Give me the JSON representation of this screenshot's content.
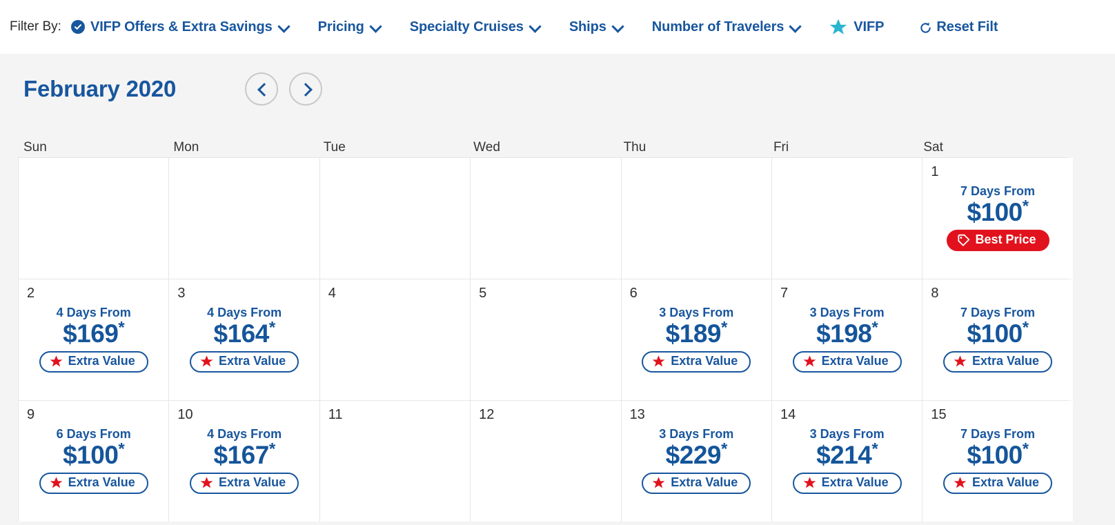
{
  "filter_bar": {
    "label": "Filter By:",
    "items": [
      {
        "id": "vifp-offers",
        "label": "VIFP Offers & Extra Savings",
        "icon": "check-circle-icon",
        "has_dropdown": true
      },
      {
        "id": "pricing",
        "label": "Pricing",
        "icon": null,
        "has_dropdown": true
      },
      {
        "id": "specialty-cruises",
        "label": "Specialty Cruises",
        "icon": null,
        "has_dropdown": true
      },
      {
        "id": "ships",
        "label": "Ships",
        "icon": null,
        "has_dropdown": true
      },
      {
        "id": "number-of-travelers",
        "label": "Number of Travelers",
        "icon": null,
        "has_dropdown": true
      },
      {
        "id": "vifp",
        "label": "VIFP",
        "icon": "star-icon",
        "has_dropdown": false
      },
      {
        "id": "reset-filters",
        "label": "Reset Filt",
        "icon": "reset-icon",
        "has_dropdown": false
      }
    ]
  },
  "calendar": {
    "month_title": "February 2020",
    "prev_label": "‹",
    "next_label": "›",
    "day_headers": [
      "Sun",
      "Mon",
      "Tue",
      "Wed",
      "Thu",
      "Fri",
      "Sat"
    ],
    "cells": [
      {
        "day": "",
        "offer": null
      },
      {
        "day": "",
        "offer": null
      },
      {
        "day": "",
        "offer": null
      },
      {
        "day": "",
        "offer": null
      },
      {
        "day": "",
        "offer": null
      },
      {
        "day": "",
        "offer": null
      },
      {
        "day": "1",
        "offer": {
          "duration": "7 Days From",
          "price": "$100",
          "asterisk": "*",
          "badge": "Best Price",
          "badge_type": "best",
          "badge_icon": "price-tag-icon"
        }
      },
      {
        "day": "2",
        "offer": {
          "duration": "4 Days From",
          "price": "$169",
          "asterisk": "*",
          "badge": "Extra Value",
          "badge_type": "extra",
          "badge_icon": "star-icon"
        }
      },
      {
        "day": "3",
        "offer": {
          "duration": "4 Days From",
          "price": "$164",
          "asterisk": "*",
          "badge": "Extra Value",
          "badge_type": "extra",
          "badge_icon": "star-icon"
        }
      },
      {
        "day": "4",
        "offer": null
      },
      {
        "day": "5",
        "offer": null
      },
      {
        "day": "6",
        "offer": {
          "duration": "3 Days From",
          "price": "$189",
          "asterisk": "*",
          "badge": "Extra Value",
          "badge_type": "extra",
          "badge_icon": "star-icon"
        }
      },
      {
        "day": "7",
        "offer": {
          "duration": "3 Days From",
          "price": "$198",
          "asterisk": "*",
          "badge": "Extra Value",
          "badge_type": "extra",
          "badge_icon": "star-icon"
        }
      },
      {
        "day": "8",
        "offer": {
          "duration": "7 Days From",
          "price": "$100",
          "asterisk": "*",
          "badge": "Extra Value",
          "badge_type": "extra",
          "badge_icon": "star-icon"
        }
      },
      {
        "day": "9",
        "offer": {
          "duration": "6 Days From",
          "price": "$100",
          "asterisk": "*",
          "badge": "Extra Value",
          "badge_type": "extra",
          "badge_icon": "star-icon"
        }
      },
      {
        "day": "10",
        "offer": {
          "duration": "4 Days From",
          "price": "$167",
          "asterisk": "*",
          "badge": "Extra Value",
          "badge_type": "extra",
          "badge_icon": "star-icon"
        }
      },
      {
        "day": "11",
        "offer": null
      },
      {
        "day": "12",
        "offer": null
      },
      {
        "day": "13",
        "offer": {
          "duration": "3 Days From",
          "price": "$229",
          "asterisk": "*",
          "badge": "Extra Value",
          "badge_type": "extra",
          "badge_icon": "star-icon"
        }
      },
      {
        "day": "14",
        "offer": {
          "duration": "3 Days From",
          "price": "$214",
          "asterisk": "*",
          "badge": "Extra Value",
          "badge_type": "extra",
          "badge_icon": "star-icon"
        }
      },
      {
        "day": "15",
        "offer": {
          "duration": "7 Days From",
          "price": "$100",
          "asterisk": "*",
          "badge": "Extra Value",
          "badge_type": "extra",
          "badge_icon": "star-icon"
        }
      }
    ]
  },
  "colors": {
    "brand_blue": "#18569e",
    "price_blue": "#15559a",
    "best_price_red": "#e1121d",
    "star_red": "#e1121d",
    "vifp_teal": "#29b5ce",
    "page_bg": "#f4f4f4",
    "cell_bg": "#ffffff",
    "grid_line": "#e6e6e6"
  }
}
